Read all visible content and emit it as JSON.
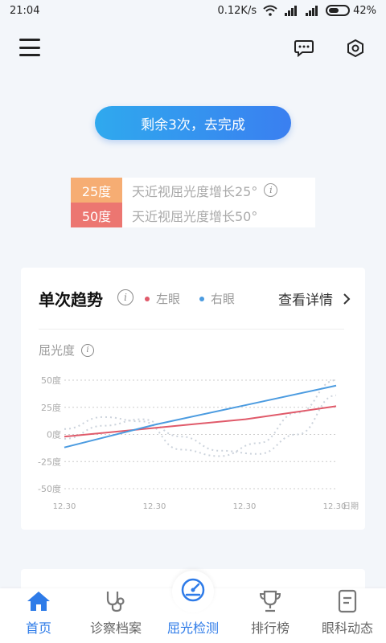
{
  "status_bar": {
    "time": "21:04",
    "speed": "0.12K/s",
    "battery": "42%"
  },
  "remaining_button": "剩余3次，去完成",
  "legend": [
    {
      "tag": "25度",
      "text": "天近视屈光度增长25°",
      "color": "#f6ad73"
    },
    {
      "tag": "50度",
      "text": "天近视屈光度增长50°",
      "color": "#ec7671"
    }
  ],
  "trend_card": {
    "title": "单次趋势",
    "left_eye": "左眼",
    "right_eye": "右眼",
    "details": "查看详情",
    "y_title": "屈光度"
  },
  "chart_data": {
    "type": "line",
    "x": [
      "12.30",
      "12.30",
      "12.30",
      "12.30"
    ],
    "x_unit": "日期",
    "y_ticks": [
      "50度",
      "25度",
      "0度",
      "-25度",
      "-50度"
    ],
    "ylim": [
      -50,
      50
    ],
    "series": [
      {
        "name": "左眼",
        "color": "#e05a6a",
        "values": [
          -2,
          6,
          14,
          26
        ]
      },
      {
        "name": "右眼",
        "color": "#4b9be0",
        "values": [
          -12,
          9,
          27,
          45
        ]
      }
    ],
    "dotted": [
      {
        "values": [
          5,
          16,
          12,
          -14,
          -20,
          -8,
          20,
          50
        ]
      },
      {
        "values": [
          -4,
          8,
          14,
          -2,
          -15,
          -18,
          0,
          36
        ]
      }
    ]
  },
  "bottom_nav": [
    {
      "label": "首页",
      "icon": "home-icon",
      "active": true
    },
    {
      "label": "诊察档案",
      "icon": "stethoscope-icon",
      "active": false
    },
    {
      "label": "屈光检测",
      "icon": "gauge-icon",
      "active": true
    },
    {
      "label": "排行榜",
      "icon": "trophy-icon",
      "active": false
    },
    {
      "label": "眼科动态",
      "icon": "document-icon",
      "active": false
    }
  ],
  "colors": {
    "accent": "#2e7be8",
    "orange": "#f6ad73",
    "red": "#ec7671"
  }
}
